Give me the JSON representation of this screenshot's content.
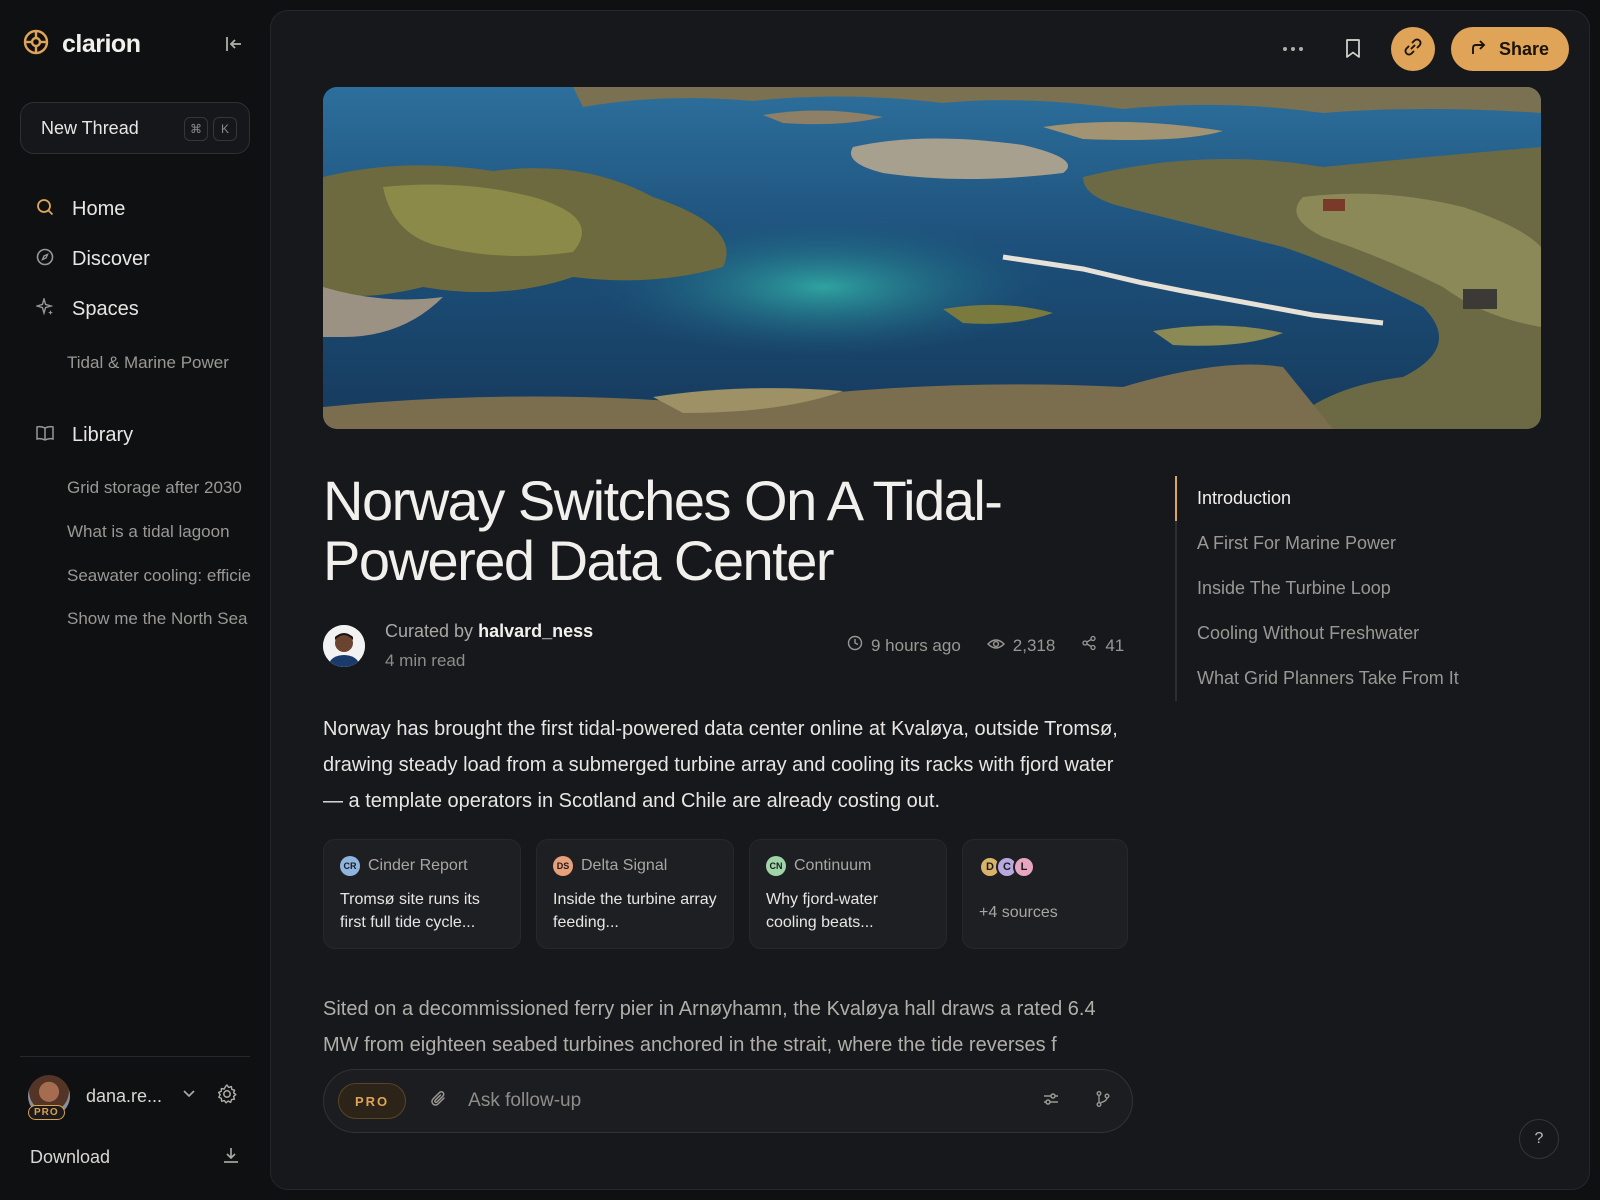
{
  "app": {
    "name": "clarion"
  },
  "sidebar": {
    "new_thread": {
      "label": "New Thread",
      "keys": [
        "⌘",
        "K"
      ]
    },
    "nav": [
      {
        "label": "Home",
        "icon": "search-icon"
      },
      {
        "label": "Discover",
        "icon": "compass-icon"
      },
      {
        "label": "Spaces",
        "icon": "sparkle-icon"
      }
    ],
    "spaces": [
      "Tidal & Marine Power"
    ],
    "library": {
      "label": "Library",
      "items": [
        "Grid storage after 2030",
        "What is a tidal lagoon",
        "Seawater cooling: efficiency",
        "Show me the North Sea"
      ]
    },
    "user": {
      "name": "dana.re...",
      "badge": "PRO"
    },
    "download_label": "Download"
  },
  "article": {
    "title": "Norway Switches On A Tidal-Powered Data Center",
    "curated_prefix": "Curated by",
    "author": "halvard_ness",
    "read_time": "4 min read",
    "time_ago": "9 hours ago",
    "views": "2,318",
    "shares": "41",
    "lede": "Norway has brought the first tidal-powered data center online at Kvaløya, outside Tromsø, drawing steady load from a submerged turbine array and cooling its racks with fjord water — a template operators in Scotland and Chile are already costing out.",
    "body": "Sited on a decommissioned ferry pier in Arnøyhamn, the Kvaløya hall draws a rated 6.4 MW from eighteen seabed turbines anchored in the strait, where the tide reverses f"
  },
  "sources": [
    {
      "badge": "CR",
      "color": "#8fb4e0",
      "name": "Cinder Report",
      "text": "Tromsø site runs its first full tide cycle..."
    },
    {
      "badge": "DS",
      "color": "#e8a07a",
      "name": "Delta Signal",
      "text": "Inside the turbine array feeding..."
    },
    {
      "badge": "CN",
      "color": "#9fd4a8",
      "name": "Continuum",
      "text": "Why fjord-water cooling beats..."
    }
  ],
  "more_sources": {
    "badges": [
      {
        "letter": "D",
        "color": "#d9b36a"
      },
      {
        "letter": "C",
        "color": "#b7a8e0"
      },
      {
        "letter": "L",
        "color": "#e8a5c0"
      }
    ],
    "label": "+4  sources"
  },
  "toc": [
    "Introduction",
    "A First For Marine Power",
    "Inside The Turbine Loop",
    "Cooling Without Freshwater",
    "What Grid Planners Take From It"
  ],
  "topbar": {
    "share_label": "Share"
  },
  "followup": {
    "pro_label": "PRO",
    "placeholder": "Ask follow-up"
  },
  "help_label": "?",
  "colors": {
    "accent": "#e0a458",
    "background": "#0f1012",
    "panel": "#17181b"
  }
}
